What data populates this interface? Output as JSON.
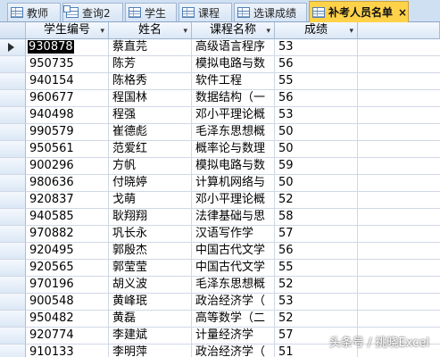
{
  "tabs": [
    {
      "label": "教师",
      "icon": "table-icon",
      "active": false
    },
    {
      "label": "查询2",
      "icon": "query-icon",
      "active": false
    },
    {
      "label": "学生",
      "icon": "table-icon",
      "active": false
    },
    {
      "label": "课程",
      "icon": "table-icon",
      "active": false
    },
    {
      "label": "选课成绩",
      "icon": "table-icon",
      "active": false
    },
    {
      "label": "补考人员名单",
      "icon": "table-icon",
      "active": true
    }
  ],
  "active_tab_close": "×",
  "grid": {
    "columns": [
      "学生编号",
      "姓名",
      "课程名称",
      "成绩"
    ],
    "header_arrow": "▾",
    "rows": [
      [
        "930878",
        "蔡直芫",
        "高级语言程序",
        "53"
      ],
      [
        "950735",
        "陈芳",
        "模拟电路与数",
        "56"
      ],
      [
        "940154",
        "陈格秀",
        "软件工程",
        "55"
      ],
      [
        "960677",
        "程国林",
        "数据结构（一",
        "56"
      ],
      [
        "940498",
        "程强",
        "邓小平理论概",
        "53"
      ],
      [
        "990579",
        "崔德彪",
        "毛泽东思想概",
        "50"
      ],
      [
        "950561",
        "范爱红",
        "概率论与数理",
        "50"
      ],
      [
        "900296",
        "方帆",
        "模拟电路与数",
        "59"
      ],
      [
        "980636",
        "付晓婷",
        "计算机网络与",
        "50"
      ],
      [
        "920837",
        "戈萌",
        "邓小平理论概",
        "52"
      ],
      [
        "940585",
        "耿翔翔",
        "法律基础与思",
        "58"
      ],
      [
        "970882",
        "巩长永",
        "汉语写作学",
        "57"
      ],
      [
        "920495",
        "郭殷杰",
        "中国古代文学",
        "56"
      ],
      [
        "920565",
        "郭莹莹",
        "中国古代文学",
        "55"
      ],
      [
        "970196",
        "胡义波",
        "毛泽东思想概",
        "52"
      ],
      [
        "900548",
        "黄峰珉",
        "政治经济学（",
        "53"
      ],
      [
        "950482",
        "黄磊",
        "高等数学（二",
        "52"
      ],
      [
        "920774",
        "李建斌",
        "计量经济学",
        "57"
      ],
      [
        "910133",
        "李明萍",
        "政治经济学（",
        "51"
      ]
    ]
  },
  "watermark": "头条号 / 挑晓Excel",
  "colors": {
    "active_tab": "#ffd24a",
    "tabbar_bg": "#cfe0f3",
    "header_bg": "#dce8f6"
  }
}
